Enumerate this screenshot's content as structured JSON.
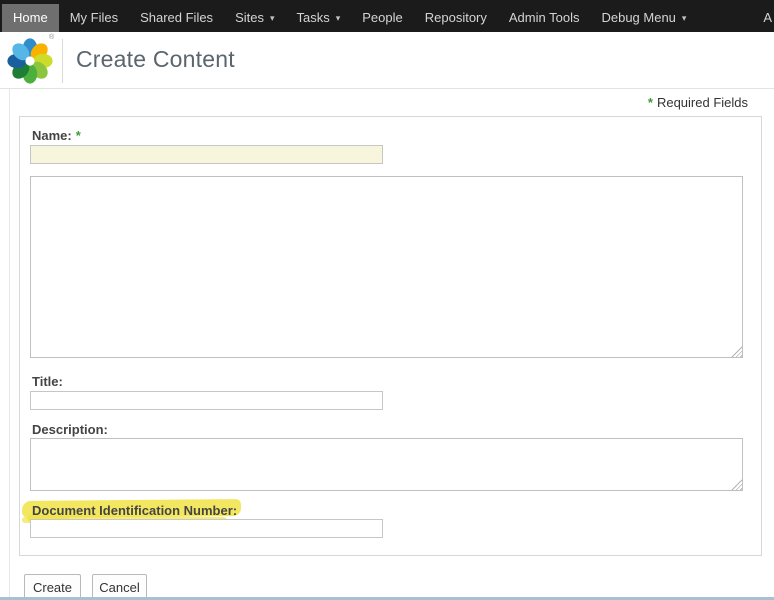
{
  "nav": {
    "dropdown_glyph": "▾",
    "items": [
      {
        "label": "Home",
        "active": true
      },
      {
        "label": "My Files"
      },
      {
        "label": "Shared Files"
      },
      {
        "label": "Sites",
        "dropdown": true
      },
      {
        "label": "Tasks",
        "dropdown": true
      },
      {
        "label": "People"
      },
      {
        "label": "Repository"
      },
      {
        "label": "Admin Tools"
      },
      {
        "label": "Debug Menu",
        "dropdown": true
      }
    ],
    "right_partial_label": "A"
  },
  "header": {
    "title": "Create Content",
    "registered_mark": "®"
  },
  "page": {
    "required_note": {
      "asterisk": "*",
      "text": "Required Fields"
    }
  },
  "form": {
    "fields": {
      "name": {
        "label": "Name:",
        "required_mark": "*",
        "value": ""
      },
      "content": {
        "value": ""
      },
      "title": {
        "label": "Title:",
        "value": ""
      },
      "description": {
        "label": "Description:",
        "value": ""
      },
      "din": {
        "label": "Document Identification Number:",
        "value": "",
        "annotation": "yellow-highlighter"
      }
    },
    "buttons": {
      "create": "Create",
      "cancel": "Cancel"
    }
  },
  "colors": {
    "nav_bg": "#1b1b1b",
    "nav_active_bg": "#6f6f6f",
    "required_asterisk": "#3f9c35",
    "name_field_bg": "#f8f5dd",
    "highlighter_yellow": "#f0e23e",
    "page_title_text": "#5b656d"
  }
}
